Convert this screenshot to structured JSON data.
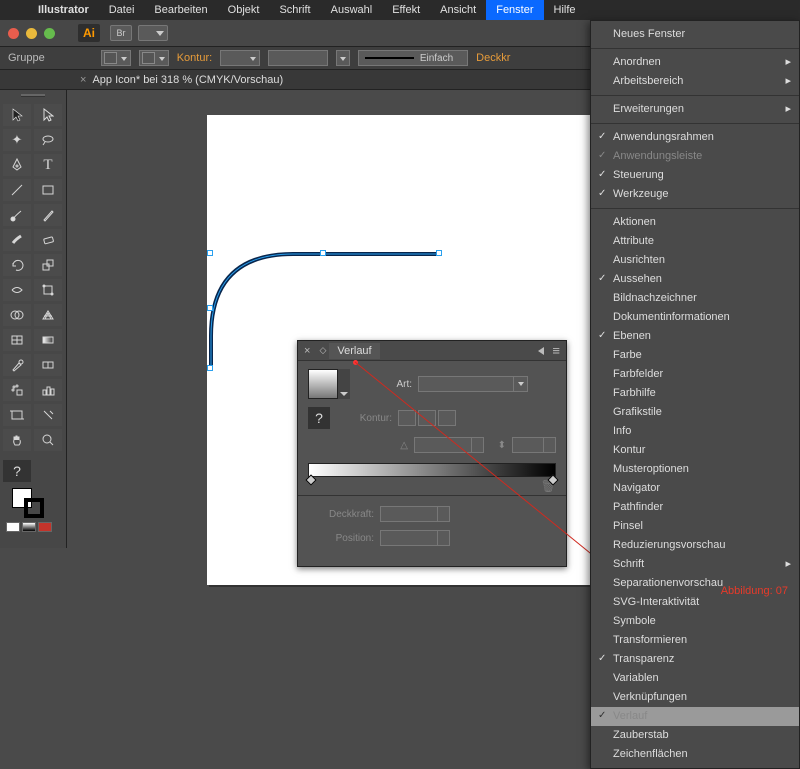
{
  "menubar": {
    "items": [
      "Illustrator",
      "Datei",
      "Bearbeiten",
      "Objekt",
      "Schrift",
      "Auswahl",
      "Effekt",
      "Ansicht",
      "Fenster",
      "Hilfe"
    ],
    "highlighted": "Fenster"
  },
  "app_icon": "Ai",
  "selection_label": "Gruppe",
  "ctrl": {
    "kontur_label": "Kontur:",
    "profile_label": "Einfach",
    "deckkraft_label": "Deckkr"
  },
  "document_tab": {
    "close": "×",
    "title": "App Icon* bei 318 % (CMYK/Vorschau)"
  },
  "toolbox": {
    "unknown": "?"
  },
  "gradient_panel": {
    "close": "×",
    "tab_label": "Verlauf",
    "art_label": "Art:",
    "kontur_label": "Kontur:",
    "winkel_icon": "△",
    "aspect_icon": "⬍",
    "deckkraft_label": "Deckkraft:",
    "position_label": "Position:"
  },
  "dropdown": {
    "sections": [
      [
        {
          "label": "Neues Fenster"
        }
      ],
      [
        {
          "label": "Anordnen",
          "arrow": true
        },
        {
          "label": "Arbeitsbereich",
          "arrow": true
        }
      ],
      [
        {
          "label": "Erweiterungen",
          "arrow": true
        }
      ],
      [
        {
          "label": "Anwendungsrahmen",
          "checked": true
        },
        {
          "label": "Anwendungsleiste",
          "dim": true,
          "checked": true
        },
        {
          "label": "Steuerung",
          "checked": true
        },
        {
          "label": "Werkzeuge",
          "checked": true
        }
      ],
      [
        {
          "label": "Aktionen"
        },
        {
          "label": "Attribute"
        },
        {
          "label": "Ausrichten"
        },
        {
          "label": "Aussehen",
          "checked": true
        },
        {
          "label": "Bildnachzeichner"
        },
        {
          "label": "Dokumentinformationen"
        },
        {
          "label": "Ebenen",
          "checked": true
        },
        {
          "label": "Farbe"
        },
        {
          "label": "Farbfelder"
        },
        {
          "label": "Farbhilfe"
        },
        {
          "label": "Grafikstile"
        },
        {
          "label": "Info"
        },
        {
          "label": "Kontur"
        },
        {
          "label": "Musteroptionen"
        },
        {
          "label": "Navigator"
        },
        {
          "label": "Pathfinder"
        },
        {
          "label": "Pinsel"
        },
        {
          "label": "Reduzierungsvorschau"
        },
        {
          "label": "Schrift",
          "arrow": true
        },
        {
          "label": "Separationenvorschau"
        },
        {
          "label": "SVG-Interaktivität"
        },
        {
          "label": "Symbole"
        },
        {
          "label": "Transformieren"
        },
        {
          "label": "Transparenz",
          "checked": true
        },
        {
          "label": "Variablen"
        },
        {
          "label": "Verknüpfungen"
        },
        {
          "label": "Verlauf",
          "checked": true,
          "highlight": true,
          "dim": true
        },
        {
          "label": "Zauberstab"
        },
        {
          "label": "Zeichenflächen"
        }
      ]
    ]
  },
  "figure_label": "Abbildung: 07"
}
